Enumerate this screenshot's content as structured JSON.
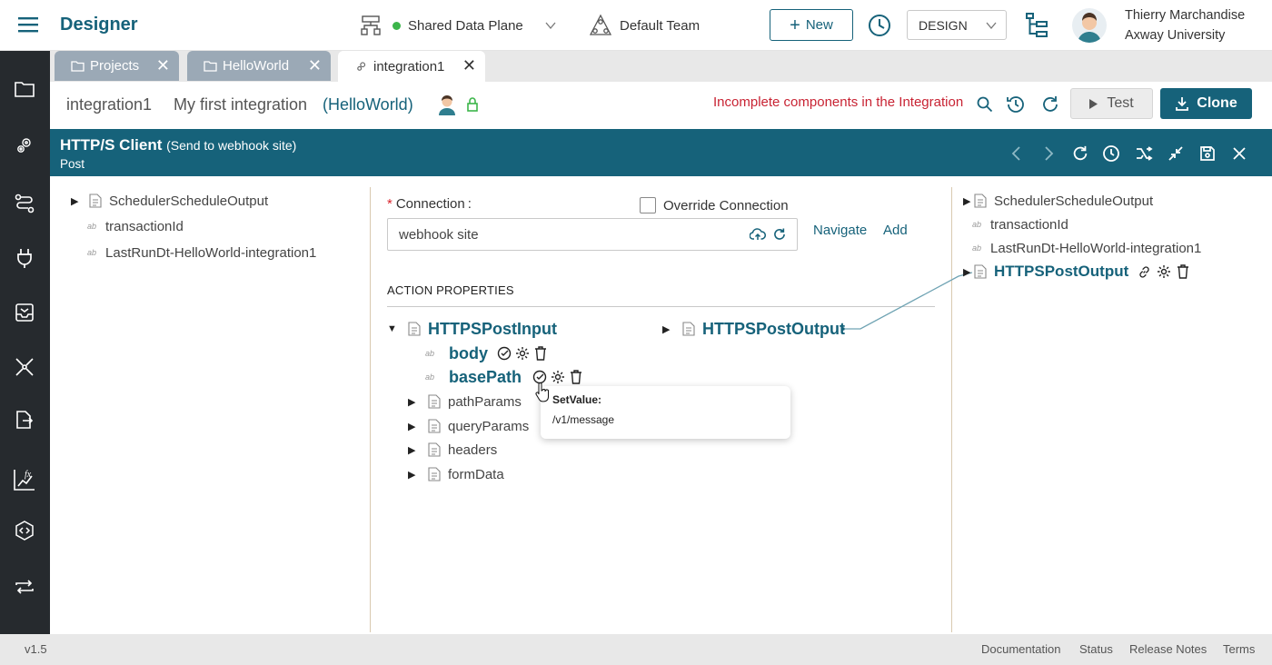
{
  "app": {
    "title": "Designer"
  },
  "header": {
    "data_plane": "Shared Data Plane",
    "team": "Default Team",
    "new_label": "New",
    "mode": "DESIGN",
    "user_name": "Thierry Marchandise",
    "user_org": "Axway University"
  },
  "tabs": [
    {
      "label": "Projects"
    },
    {
      "label": "HelloWorld"
    },
    {
      "label": "integration1"
    }
  ],
  "integration": {
    "name": "integration1",
    "description": "My first integration",
    "project": "(HelloWorld)",
    "warning": "Incomplete components in the Integration",
    "test_label": "Test",
    "clone_label": "Clone"
  },
  "component": {
    "title": "HTTP/S Client",
    "subtitle": "(Send to webhook site)",
    "method": "Post"
  },
  "left_panel": {
    "items": [
      "SchedulerScheduleOutput",
      "transactionId",
      "LastRunDt-HelloWorld-integration1"
    ]
  },
  "center_panel": {
    "connection_label": "Connection",
    "connection_value": "webhook site",
    "override_label": "Override Connection",
    "navigate_label": "Navigate",
    "add_label": "Add",
    "action_properties_label": "ACTION PROPERTIES",
    "input_root": "HTTPSPostInput",
    "input_children": [
      "body",
      "basePath",
      "pathParams",
      "queryParams",
      "headers",
      "formData"
    ],
    "output_root": "HTTPSPostOutput",
    "tooltip_title": "SetValue:",
    "tooltip_value": "/v1/message"
  },
  "right_panel": {
    "items": [
      "SchedulerScheduleOutput",
      "transactionId",
      "LastRunDt-HelloWorld-integration1",
      "HTTPSPostOutput"
    ]
  },
  "footer": {
    "version": "v1.5",
    "links": [
      "Documentation",
      "Status",
      "Release Notes",
      "Terms"
    ]
  }
}
